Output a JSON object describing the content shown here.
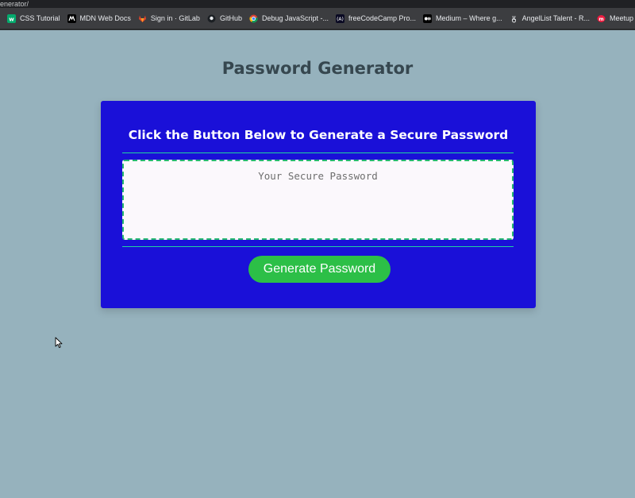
{
  "browser": {
    "url_fragment": "enerator/",
    "bookmarks": [
      {
        "label": "CSS Tutorial",
        "icon": "w3schools-icon",
        "color": "#04aa6d"
      },
      {
        "label": "MDN Web Docs",
        "icon": "mdn-icon",
        "color": "#000000"
      },
      {
        "label": "Sign in · GitLab",
        "icon": "gitlab-icon",
        "color": "#e24329"
      },
      {
        "label": "GitHub",
        "icon": "github-icon",
        "color": "#1b1f23"
      },
      {
        "label": "Debug JavaScript -...",
        "icon": "chrome-icon",
        "color": "#4285f4"
      },
      {
        "label": "freeCodeCamp Pro...",
        "icon": "freecodecamp-icon",
        "color": "#0a0a23"
      },
      {
        "label": "Medium – Where g...",
        "icon": "medium-icon",
        "color": "#000000"
      },
      {
        "label": "AngelList Talent - R...",
        "icon": "angellist-icon",
        "color": "#3c3d40"
      },
      {
        "label": "Meetup - We are w...",
        "icon": "meetup-icon",
        "color": "#ed1c40"
      }
    ]
  },
  "page": {
    "title": "Password Generator"
  },
  "card": {
    "header": "Click the Button Below to Generate a Secure Password",
    "password_value": "",
    "password_placeholder": "Your Secure Password",
    "generate_label": "Generate Password"
  },
  "colors": {
    "page_bg": "#96b2bd",
    "card_bg": "#1a10d8",
    "accent": "#2cbf47",
    "divider": "#20d3a0"
  }
}
